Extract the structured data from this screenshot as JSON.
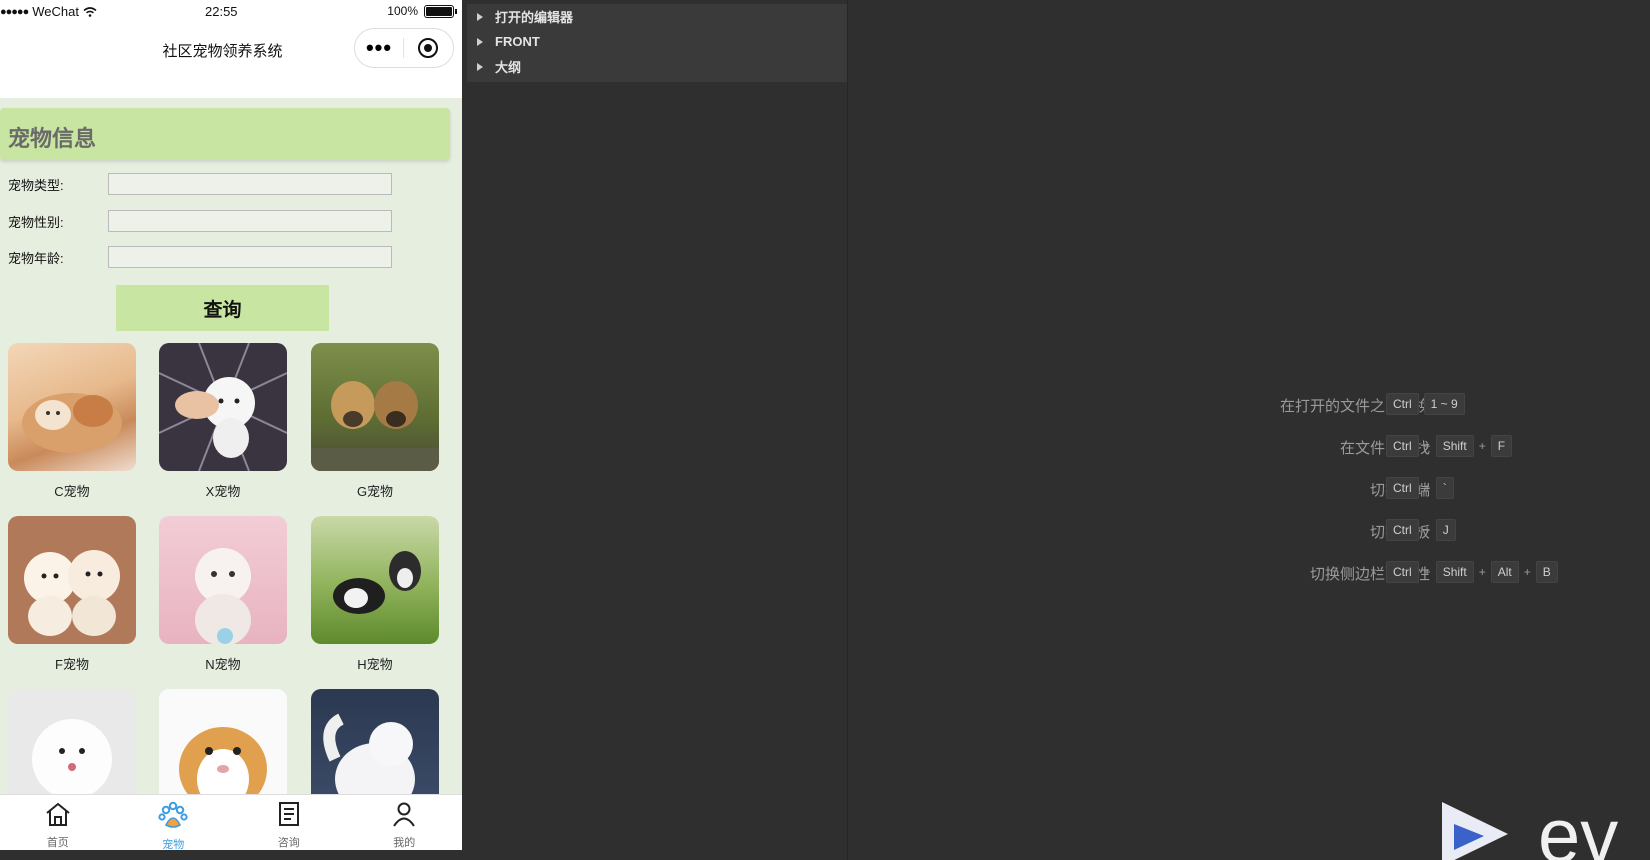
{
  "phone": {
    "status": {
      "carrier": "WeChat",
      "signal": "●●●●●",
      "time": "22:55",
      "battery": "100%"
    },
    "nav_title": "社区宠物领养系统",
    "section_title": "宠物信息",
    "form": {
      "type_label": "宠物类型:",
      "gender_label": "宠物性别:",
      "age_label": "宠物年龄:",
      "query_button": "查询"
    },
    "pets": [
      {
        "name": "C宠物"
      },
      {
        "name": "X宠物"
      },
      {
        "name": "G宠物"
      },
      {
        "name": "F宠物"
      },
      {
        "name": "N宠物"
      },
      {
        "name": "H宠物"
      },
      {
        "name": ""
      },
      {
        "name": ""
      },
      {
        "name": ""
      }
    ],
    "tabs": [
      {
        "label": "首页",
        "icon": "home-icon"
      },
      {
        "label": "宠物",
        "icon": "paw-icon",
        "active": true
      },
      {
        "label": "咨询",
        "icon": "document-icon"
      },
      {
        "label": "我的",
        "icon": "user-icon"
      }
    ]
  },
  "explorer": {
    "items": [
      "打开的编辑器",
      "FRONT",
      "大纲"
    ]
  },
  "shortcuts": [
    {
      "label": "在打开的文件之间切换",
      "keys": [
        "Ctrl",
        "1 ~ 9"
      ],
      "joiners": [
        ""
      ]
    },
    {
      "label": "在文件中查找",
      "keys": [
        "Ctrl",
        "Shift",
        "F"
      ],
      "joiners": [
        "+",
        "+"
      ]
    },
    {
      "label": "切换终端",
      "keys": [
        "Ctrl",
        "`"
      ],
      "joiners": [
        "+"
      ]
    },
    {
      "label": "切换面板",
      "keys": [
        "Ctrl",
        "J"
      ],
      "joiners": [
        "+"
      ]
    },
    {
      "label": "切换侧边栏可见性",
      "keys": [
        "Ctrl",
        "Shift",
        "Alt",
        "B"
      ],
      "joiners": [
        "+",
        "+",
        "+"
      ]
    }
  ],
  "brand": {
    "text": "ev"
  },
  "colors": {
    "accent_green": "#c8e6a1",
    "tab_active": "#3f9de0",
    "ide_bg": "#2f2f2f"
  }
}
